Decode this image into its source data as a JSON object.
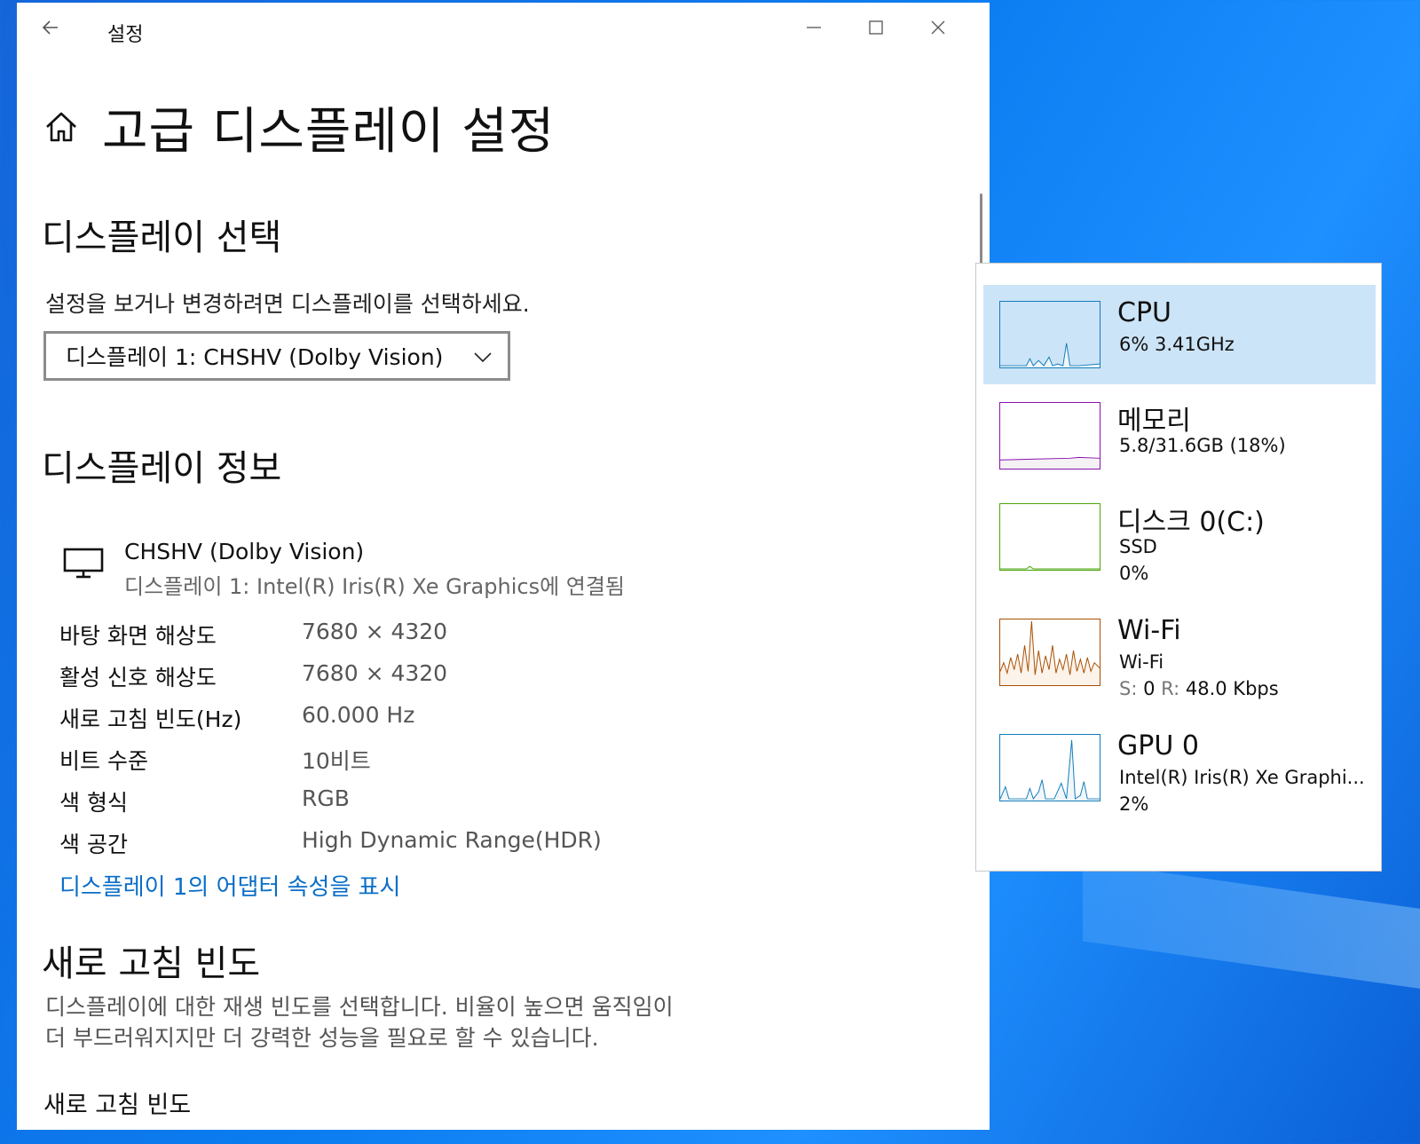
{
  "window": {
    "app_title": "설정",
    "page_title": "고급 디스플레이 설정"
  },
  "select_display": {
    "heading": "디스플레이 선택",
    "description": "설정을 보거나 변경하려면 디스플레이를 선택하세요.",
    "dropdown_value": "디스플레이 1: CHSHV (Dolby Vision)"
  },
  "display_info": {
    "heading": "디스플레이 정보",
    "name": "CHSHV (Dolby Vision)",
    "connection": "디스플레이 1: Intel(R) Iris(R) Xe Graphics에 연결됨",
    "rows": [
      {
        "label": "바탕 화면 해상도",
        "value": "7680 × 4320"
      },
      {
        "label": "활성 신호 해상도",
        "value": "7680 × 4320"
      },
      {
        "label": "새로 고침 빈도(Hz)",
        "value": "60.000 Hz"
      },
      {
        "label": "비트 수준",
        "value": "10비트"
      },
      {
        "label": "색 형식",
        "value": "RGB"
      },
      {
        "label": "색 공간",
        "value": "High Dynamic Range(HDR)"
      }
    ],
    "adapter_link": "디스플레이 1의 어댑터 속성을 표시"
  },
  "refresh_rate": {
    "heading": "새로 고침 빈도",
    "description_line1": "디스플레이에 대한 재생 빈도를 선택합니다. 비율이 높으면 움직임이",
    "description_line2": "더 부드러워지지만 더 강력한 성능을 필요로 할 수 있습니다.",
    "subheading": "새로 고침 빈도"
  },
  "task_manager": {
    "items": [
      {
        "title": "CPU",
        "line1": "6% 3.41GHz",
        "color": "#117dbb",
        "fill": "#f1f6fa",
        "active": true
      },
      {
        "title": "메모리",
        "line1": "5.8/31.6GB (18%)",
        "color": "#8b12ae",
        "fill": "#f4f2f4"
      },
      {
        "title": "디스크 0(C:)",
        "line1": "SSD",
        "line2": "0%",
        "color": "#4da60c",
        "fill": "#eff7ea"
      },
      {
        "title": "Wi-Fi",
        "line1": "Wi-Fi",
        "send_label": "S:",
        "send_value": "0",
        "recv_label": "R:",
        "recv_value": "48.0 Kbps",
        "color": "#a74f01",
        "fill": "#fcf3eb"
      },
      {
        "title": "GPU 0",
        "line1": "Intel(R) Iris(R) Xe Graphi...",
        "line2": "2%",
        "color": "#117dbb",
        "fill": "#f1f6fa"
      }
    ]
  },
  "icons": {
    "back": "back-arrow-icon",
    "minimize": "minimize-icon",
    "maximize": "maximize-icon",
    "close": "close-icon",
    "home": "home-icon",
    "monitor": "monitor-icon",
    "chevron": "chevron-down-icon"
  }
}
